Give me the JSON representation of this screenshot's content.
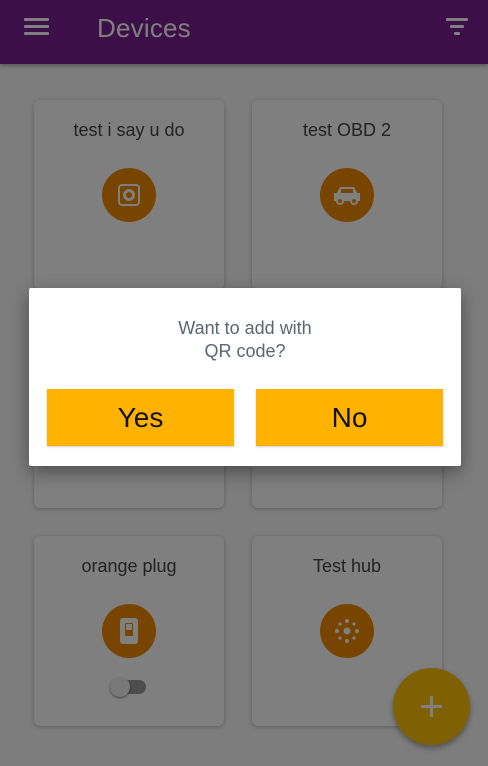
{
  "app_bar": {
    "title": "Devices",
    "menu_icon": "menu-icon",
    "filter_icon": "filter-icon",
    "color": "#7a1f93"
  },
  "devices": [
    {
      "name": "test i say u do",
      "icon": "camera-icon"
    },
    {
      "name": "test OBD 2",
      "icon": "car-icon"
    },
    {
      "name": "",
      "icon": ""
    },
    {
      "name": "",
      "icon": ""
    },
    {
      "name": "orange plug",
      "icon": "plug-switch-icon",
      "toggle": "off"
    },
    {
      "name": "Test hub",
      "icon": "hub-icon"
    }
  ],
  "icon_color": "#f08a00",
  "fab": {
    "icon": "plus-icon",
    "color": "#ffc107"
  },
  "dialog": {
    "message": "Want to add with\nQR code?",
    "yes_label": "Yes",
    "no_label": "No",
    "button_color": "#ffb300"
  }
}
